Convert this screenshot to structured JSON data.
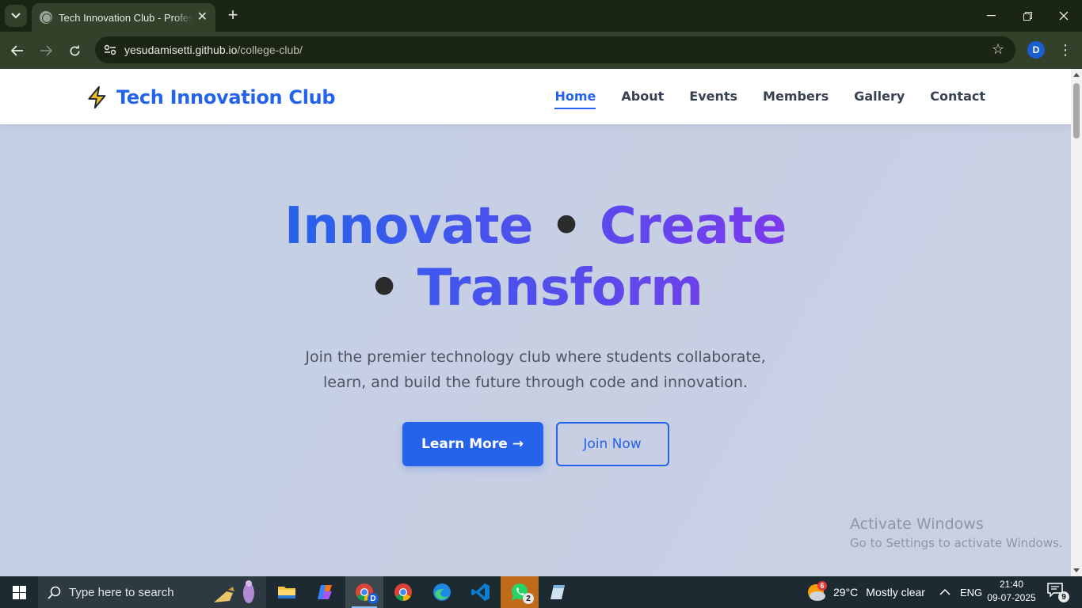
{
  "browser": {
    "tab_title": "Tech Innovation Club - Professional",
    "url_host": "yesudamisetti.github.io",
    "url_path": "/college-club/",
    "profile_initial": "D"
  },
  "site": {
    "brand": "Tech Innovation Club",
    "nav": [
      "Home",
      "About",
      "Events",
      "Members",
      "Gallery",
      "Contact"
    ],
    "active_nav": "Home",
    "hero": {
      "title_part1": "Innovate",
      "title_part2": "Create",
      "title_part3": "Transform",
      "separator": "•",
      "subtitle": "Join the premier technology club where students collaborate, learn, and build the future through code and innovation.",
      "primary_button": "Learn More →",
      "secondary_button": "Join Now"
    },
    "colors": {
      "primary": "#2563eb",
      "accent": "#7c3aed"
    }
  },
  "watermark": {
    "line1": "Activate Windows",
    "line2": "Go to Settings to activate Windows."
  },
  "taskbar": {
    "search_placeholder": "Type here to search",
    "weather_temp": "29°C",
    "weather_text": "Mostly clear",
    "weather_badge": "6",
    "language": "ENG",
    "time": "21:40",
    "date": "09-07-2025",
    "notification_count": "9",
    "whatsapp_badge": "2",
    "chrome_badge": "D"
  }
}
